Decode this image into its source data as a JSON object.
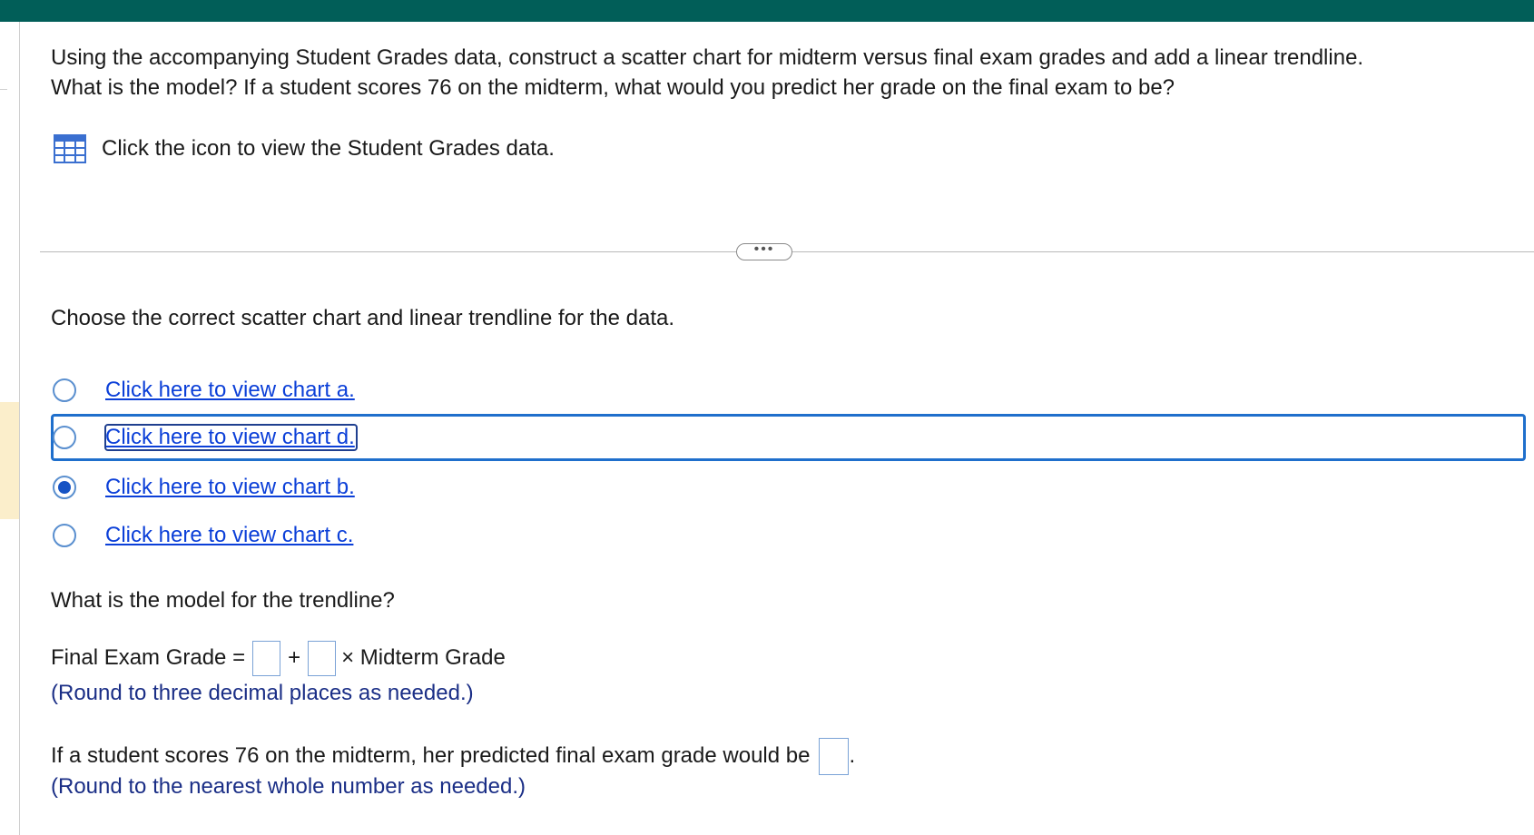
{
  "question": {
    "line1": "Using the accompanying Student Grades data, construct a scatter chart for midterm versus final exam grades and add a linear trendline.",
    "line2": "What is the model? If a student scores 76 on the midterm, what would you predict her grade on the final exam to be?"
  },
  "data_link": {
    "icon": "table-grid-icon",
    "label": "Click the icon to view the Student Grades data."
  },
  "more_button": {
    "label": "•••"
  },
  "choose_prompt": "Choose the correct scatter chart and linear trendline for the data.",
  "options": [
    {
      "label": "Click here to view chart a.",
      "selected": false
    },
    {
      "label": "Click here to view chart d.",
      "selected": false,
      "focused": true
    },
    {
      "label": "Click here to view chart b.",
      "selected": true
    },
    {
      "label": "Click here to view chart c.",
      "selected": false
    }
  ],
  "model_question": "What is the model for the trendline?",
  "equation": {
    "lhs": "Final Exam Grade =",
    "plus": "+",
    "times_label": "× Midterm Grade",
    "intercept_value": "",
    "slope_value": ""
  },
  "round_three": "(Round to three decimal places as needed.)",
  "prediction": {
    "text": "If a student scores 76 on the midterm, her predicted final exam grade would be",
    "value": "",
    "period": "."
  },
  "round_whole": "(Round to the nearest whole number as needed.)",
  "colors": {
    "topbar": "#015e58",
    "link": "#0b3fd8",
    "note": "#1a2e86",
    "radio_selected": "#1653c4",
    "focus": "#1f6fcc"
  }
}
